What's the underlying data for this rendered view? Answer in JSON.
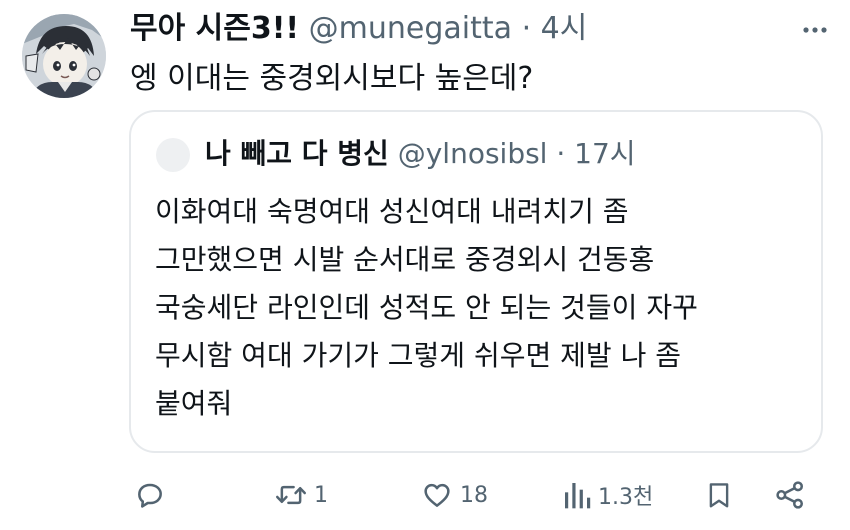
{
  "tweet": {
    "display_name": "무아 시즌3!!",
    "handle": "@munegaitta",
    "separator": "·",
    "time": "4시",
    "text": "엥 이대는 중경외시보다 높은데?",
    "avatar_icon": "anime-boy-avatar-icon",
    "more_icon": "more-dots-icon"
  },
  "quote": {
    "display_name": "나 빼고 다 병신",
    "handle": "@ylnosibsl",
    "separator": "·",
    "time": "17시",
    "lines": [
      "이화여대 숙명여대 성신여대 내려치기 좀",
      "그만했으면 시발 순서대로 중경외시 건동홍",
      "국숭세단 라인인데 성적도 안 되는 것들이 자꾸",
      "무시함 여대 가기가 그렇게 쉬우면 제발 나 좀",
      "붙여줘"
    ]
  },
  "actions": {
    "reply": {
      "icon": "reply-bubble-icon",
      "count": ""
    },
    "retweet": {
      "icon": "retweet-icon",
      "count": "1"
    },
    "like": {
      "icon": "heart-icon",
      "count": "18"
    },
    "views": {
      "icon": "views-bar-chart-icon",
      "count": "1.3천"
    },
    "bookmark": {
      "icon": "bookmark-icon",
      "count": ""
    },
    "share": {
      "icon": "share-icon",
      "count": ""
    }
  },
  "colors": {
    "text_primary": "#0f1419",
    "text_secondary": "#536471",
    "border": "#e6e9ec"
  }
}
